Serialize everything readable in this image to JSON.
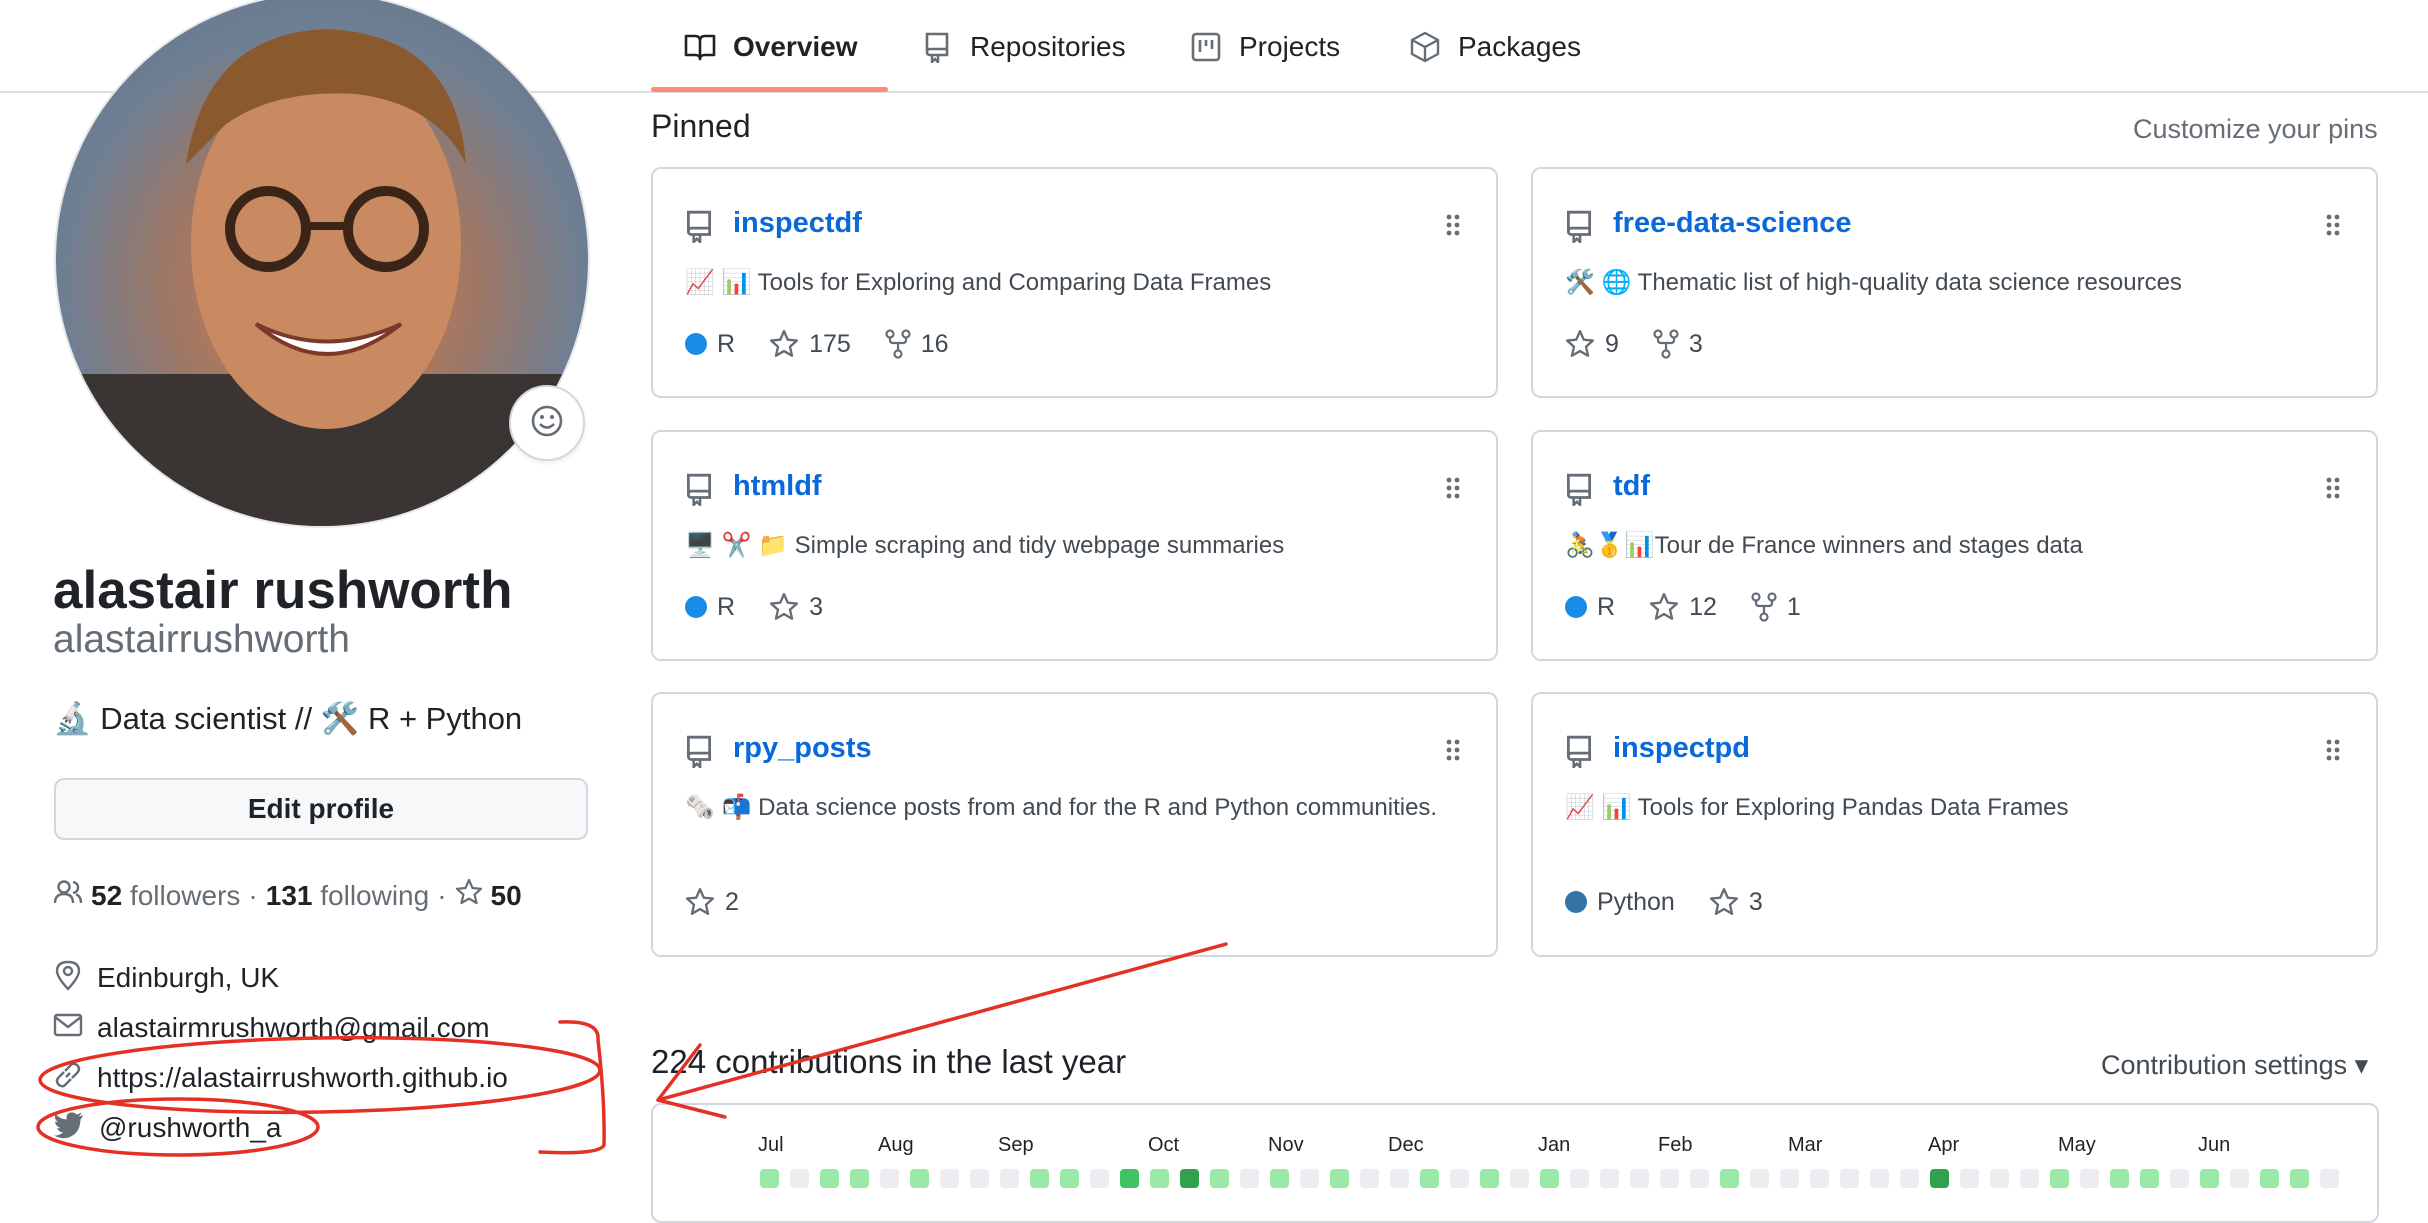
{
  "tabs": [
    {
      "label": "Overview",
      "icon": "book-icon",
      "active": true
    },
    {
      "label": "Repositories",
      "icon": "repo-icon"
    },
    {
      "label": "Projects",
      "icon": "project-icon"
    },
    {
      "label": "Packages",
      "icon": "package-icon"
    }
  ],
  "profile": {
    "name": "alastair rushworth",
    "login": "alastairrushworth",
    "bio": "🔬 Data scientist // 🛠️ R + Python",
    "edit_label": "Edit profile",
    "followers_count": "52",
    "followers_label": "followers",
    "following_count": "131",
    "following_label": "following",
    "stars_count": "50",
    "separator": "·",
    "location": "Edinburgh, UK",
    "email": "alastairmrushworth@gmail.com",
    "website": "https://alastairrushworth.github.io",
    "twitter": "@rushworth_a"
  },
  "pinned": {
    "title": "Pinned",
    "customize_label": "Customize your pins",
    "repos": [
      {
        "name": "inspectdf",
        "description": "📈 📊 Tools for Exploring and Comparing Data Frames",
        "language": "R",
        "language_color": "#198ce7",
        "stars": "175",
        "forks": "16"
      },
      {
        "name": "free-data-science",
        "description": "🛠️ 🌐 Thematic list of high-quality data science resources",
        "language": "",
        "language_color": "",
        "stars": "9",
        "forks": "3"
      },
      {
        "name": "htmldf",
        "description": "🖥️ ✂️ 📁 Simple scraping and tidy webpage summaries",
        "language": "R",
        "language_color": "#198ce7",
        "stars": "3",
        "forks": ""
      },
      {
        "name": "tdf",
        "description": "🚴🥇📊Tour de France winners and stages data",
        "language": "R",
        "language_color": "#198ce7",
        "stars": "12",
        "forks": "1"
      },
      {
        "name": "rpy_posts",
        "description": "🗞️ 📬 Data science posts from and for the R and Python communities.",
        "language": "",
        "language_color": "",
        "stars": "2",
        "forks": ""
      },
      {
        "name": "inspectpd",
        "description": "📈 📊 Tools for Exploring Pandas Data Frames",
        "language": "Python",
        "language_color": "#3572a5",
        "stars": "3",
        "forks": ""
      }
    ]
  },
  "contributions": {
    "title": "224 contributions in the last year",
    "settings_label": "Contribution settings ▾",
    "months": [
      "Jul",
      "Aug",
      "Sep",
      "Oct",
      "Nov",
      "Dec",
      "Jan",
      "Feb",
      "Mar",
      "Apr",
      "May",
      "Jun"
    ],
    "levels": [
      1,
      0,
      1,
      1,
      0,
      1,
      0,
      0,
      0,
      1,
      1,
      0,
      2,
      1,
      3,
      1,
      0,
      1,
      0,
      1,
      0,
      0,
      1,
      0,
      1,
      0,
      1,
      0,
      0,
      0,
      0,
      0,
      1,
      0,
      0,
      0,
      0,
      0,
      0,
      3,
      0,
      0,
      0,
      1,
      0,
      1,
      1,
      0,
      1,
      0,
      1,
      1,
      0,
      1,
      0,
      0,
      0,
      0,
      0,
      0,
      1,
      0,
      0
    ],
    "colors": [
      "#ebedf0",
      "#9be9a8",
      "#40c463",
      "#30a14e"
    ]
  },
  "colors": {
    "link": "#0969da",
    "tab_underline": "#fd8c73",
    "annotation": "#e53123"
  }
}
